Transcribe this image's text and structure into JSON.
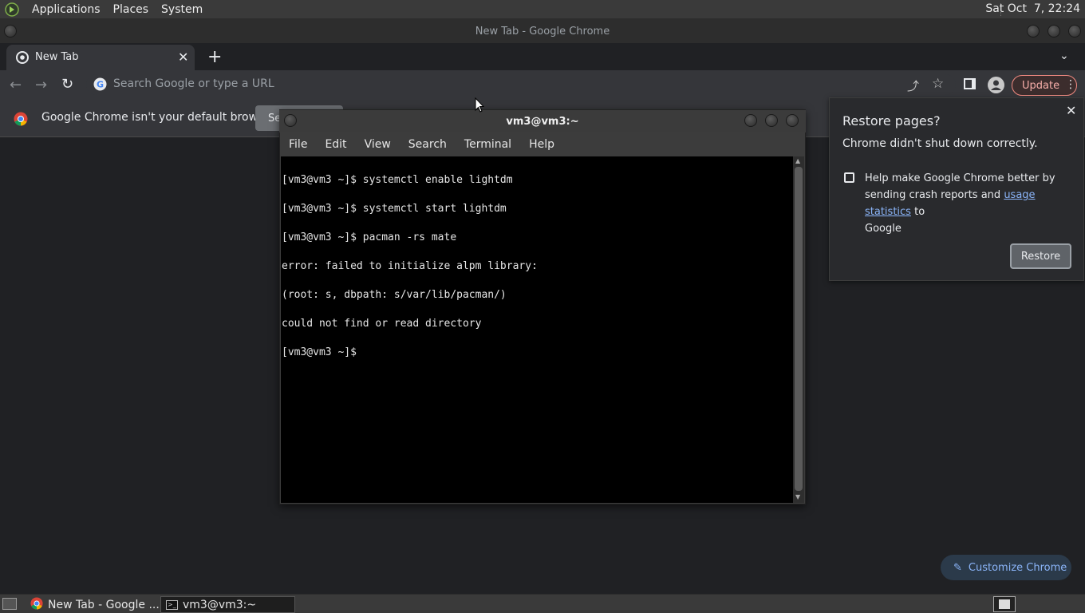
{
  "top_panel": {
    "menus": [
      "Applications",
      "Places",
      "System"
    ],
    "clock": "Sat Oct  7, 22:24"
  },
  "chrome": {
    "window_title": "New Tab - Google Chrome",
    "tab_title": "New Tab",
    "omnibox_placeholder": "Search Google or type a URL",
    "update_label": "Update",
    "infobar_text": "Google Chrome isn't your default browser",
    "infobar_button_label": "Se",
    "customize_label": "Customize Chrome",
    "restore_popup": {
      "title": "Restore pages?",
      "message": "Chrome didn't shut down correctly.",
      "checkbox_text_1": "Help make Google Chrome better by",
      "checkbox_text_2": "sending crash reports and",
      "link_text": "usage statistics",
      "checkbox_text_3": "to",
      "checkbox_text_4": "Google",
      "restore_label": "Restore"
    }
  },
  "terminal": {
    "title": "vm3@vm3:~",
    "menus": [
      "File",
      "Edit",
      "View",
      "Search",
      "Terminal",
      "Help"
    ],
    "lines": [
      "[vm3@vm3 ~]$ systemctl enable lightdm",
      "[vm3@vm3 ~]$ systemctl start lightdm",
      "[vm3@vm3 ~]$ pacman -rs mate",
      "error: failed to initialize alpm library:",
      "(root: s, dbpath: s/var/lib/pacman/)",
      "could not find or read directory",
      "[vm3@vm3 ~]$ "
    ]
  },
  "taskbar": {
    "tasks": [
      "New Tab - Google ...",
      "vm3@vm3:~"
    ]
  },
  "colors": {
    "accent_link": "#8ab4f8",
    "update_border": "#f28b82"
  }
}
